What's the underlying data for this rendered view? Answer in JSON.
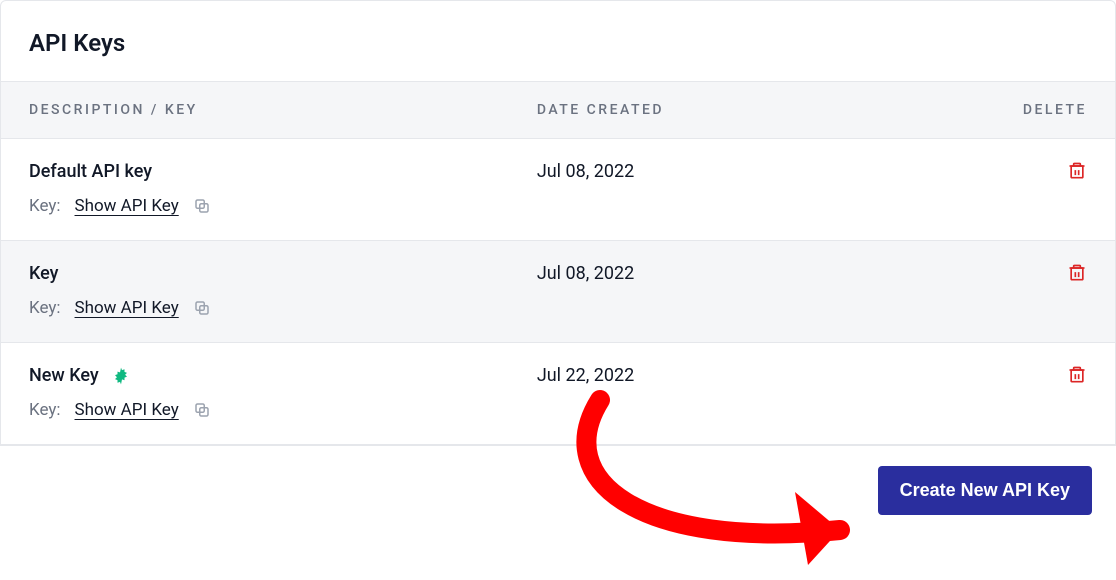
{
  "panel": {
    "title": "API Keys"
  },
  "table": {
    "headers": {
      "description": "DESCRIPTION / KEY",
      "date": "DATE CREATED",
      "delete": "DELETE"
    },
    "key_label": "Key:",
    "show_link": "Show API Key",
    "rows": [
      {
        "name": "Default API key",
        "date": "Jul 08, 2022",
        "new": false
      },
      {
        "name": "Key",
        "date": "Jul 08, 2022",
        "new": false
      },
      {
        "name": "New Key",
        "date": "Jul 22, 2022",
        "new": true
      }
    ]
  },
  "actions": {
    "create": "Create New API Key"
  }
}
